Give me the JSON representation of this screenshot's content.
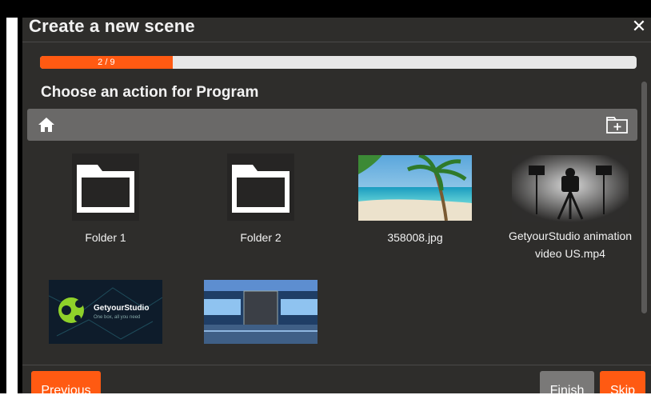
{
  "dialog": {
    "title": "Create a new scene",
    "close_icon": "close-icon",
    "progress": {
      "label": "2 / 9",
      "current": 2,
      "total": 9,
      "fraction": 0.2222
    },
    "subtitle": "Choose an action for Program",
    "toolbar": {
      "home_icon": "home-icon",
      "new_folder_icon": "new-folder-icon"
    },
    "items": [
      {
        "label": "Folder 1",
        "type": "folder"
      },
      {
        "label": "Folder 2",
        "type": "folder"
      },
      {
        "label": "358008.jpg",
        "type": "image"
      },
      {
        "label_line1": "GetyourStudio animation",
        "label_line2": "video US.mp4",
        "type": "video"
      },
      {
        "label": "",
        "type": "image",
        "thumb_text": "GetyourStudio",
        "thumb_subtext": "One box, all you need"
      },
      {
        "label": "",
        "type": "image"
      }
    ],
    "buttons": {
      "previous": "Previous",
      "finish": "Finish",
      "skip": "Skip"
    },
    "colors": {
      "accent": "#ff5a12",
      "background": "#2e2d2b",
      "toolbar": "#6a6968"
    }
  }
}
